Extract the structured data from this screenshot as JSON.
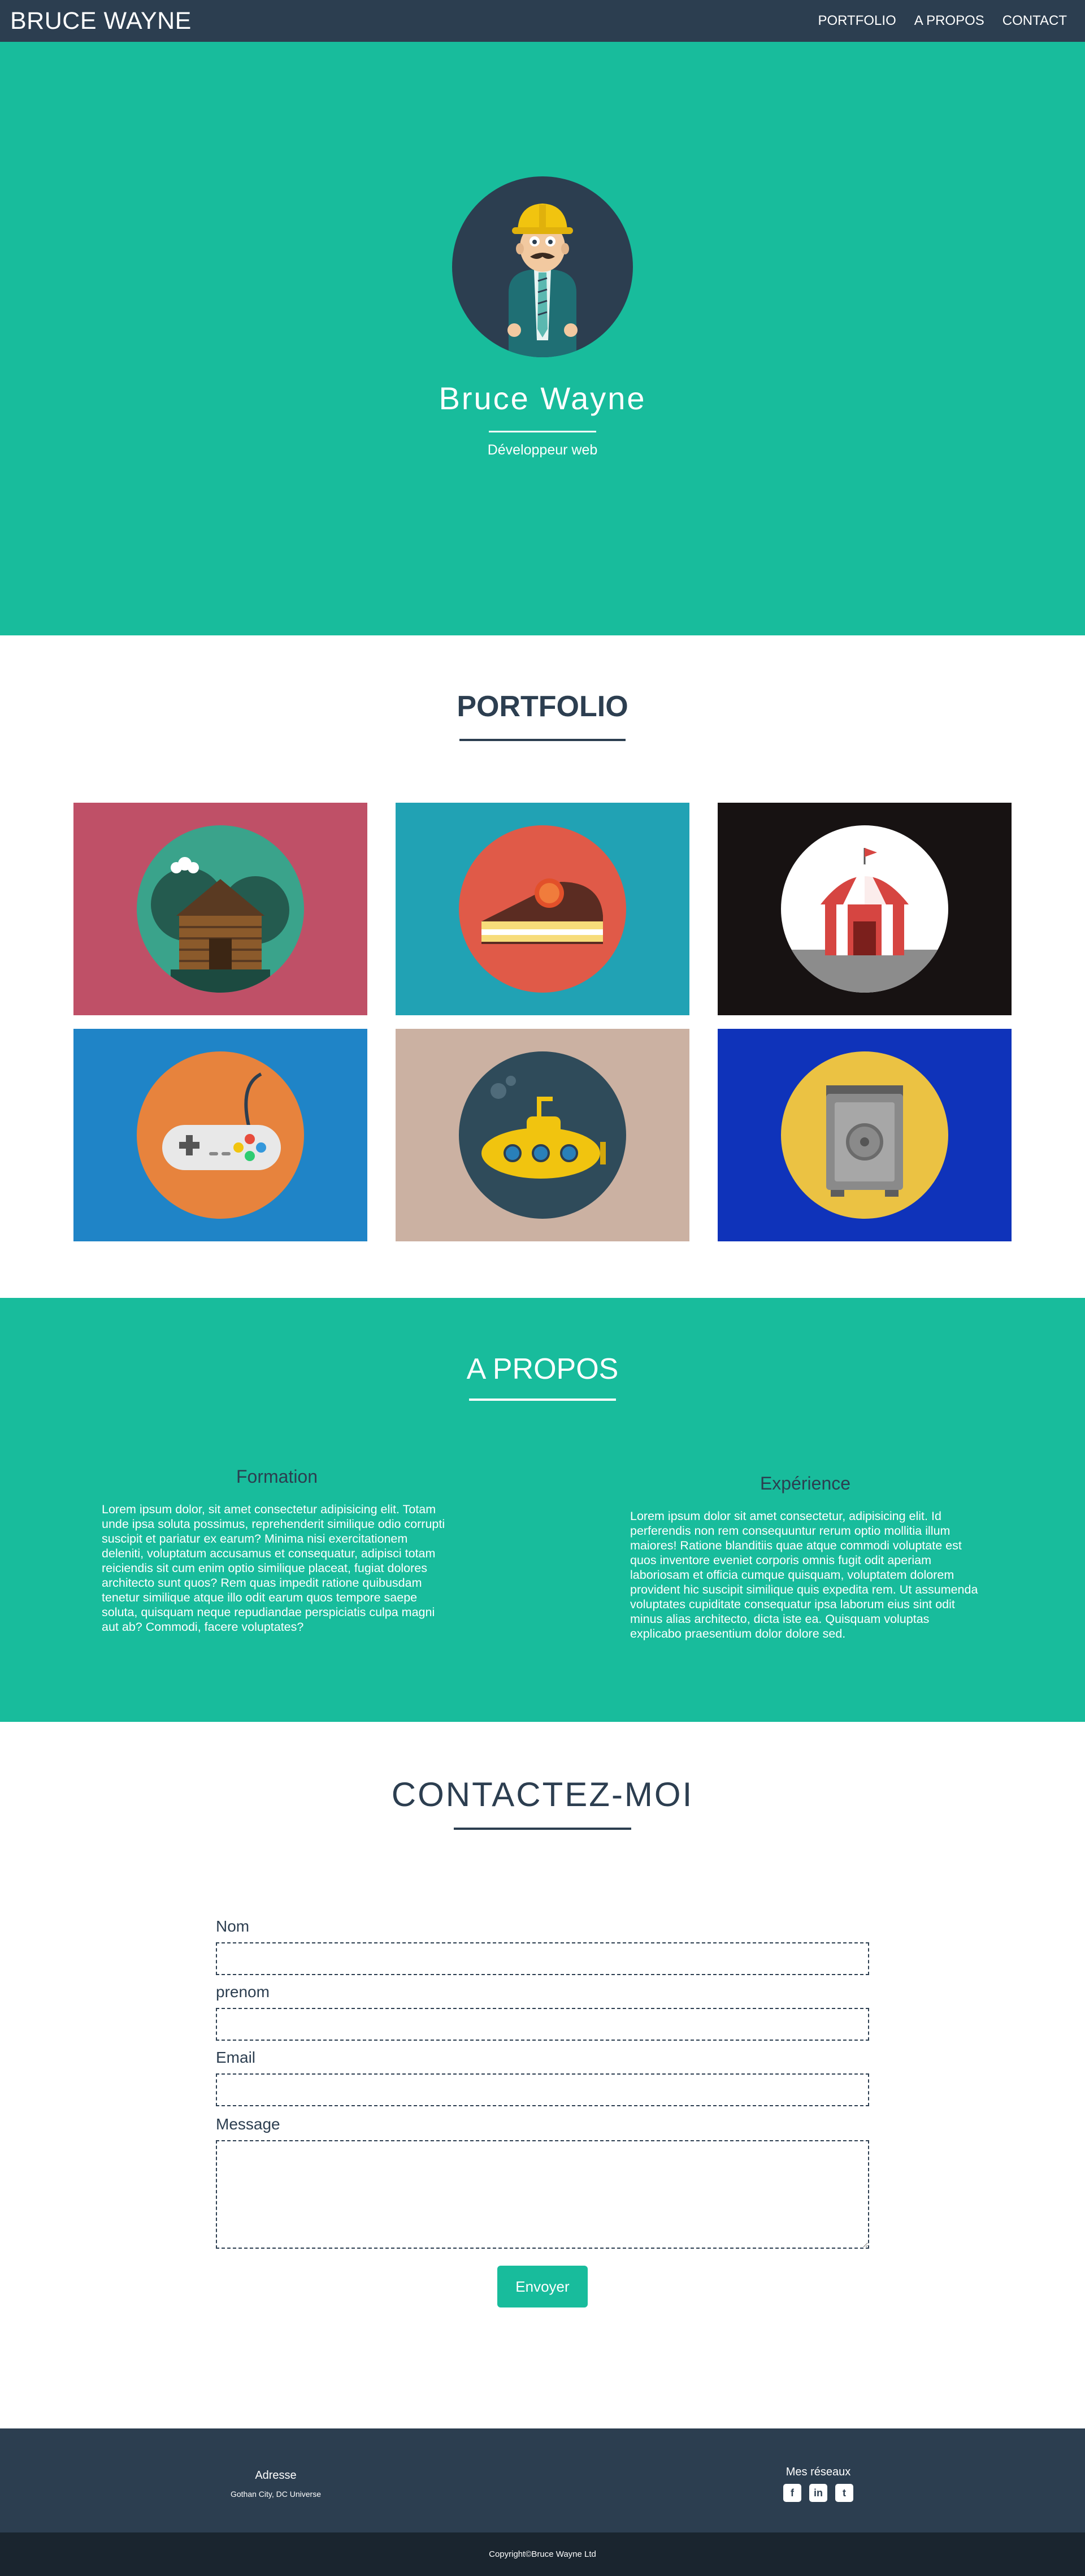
{
  "navbar": {
    "brand": "BRUCE WAYNE",
    "links": [
      "PORTFOLIO",
      "A PROPOS",
      "CONTACT"
    ]
  },
  "hero": {
    "name": "Bruce Wayne",
    "subtitle": "Développeur web",
    "avatar_icon": "builder-avatar-icon"
  },
  "portfolio": {
    "title": "PORTFOLIO",
    "items": [
      {
        "icon": "cabin-icon",
        "bg": "#bf5067",
        "circle": "#3aa38b"
      },
      {
        "icon": "cake-icon",
        "bg": "#21a2b4",
        "circle": "#e05a48"
      },
      {
        "icon": "circus-tent-icon",
        "bg": "#171212",
        "circle": "#ffffff"
      },
      {
        "icon": "game-controller-icon",
        "bg": "#1f84c7",
        "circle": "#e7833d"
      },
      {
        "icon": "submarine-icon",
        "bg": "#cbb1a2",
        "circle": "#2f4b5a"
      },
      {
        "icon": "safe-icon",
        "bg": "#0f33ba",
        "circle": "#ebc243"
      }
    ]
  },
  "about": {
    "title": "A PROPOS",
    "formation": {
      "heading": "Formation",
      "text": "Lorem ipsum dolor, sit amet consectetur adipisicing elit. Totam unde ipsa soluta possimus, reprehenderit similique odio corrupti suscipit et pariatur ex earum? Minima nisi exercitationem deleniti, voluptatum accusamus et consequatur, adipisci totam reiciendis sit cum enim optio similique placeat, fugiat dolores architecto sunt quos? Rem quas impedit ratione quibusdam tenetur similique atque illo odit earum quos tempore saepe soluta, quisquam neque repudiandae perspiciatis culpa magni aut ab? Commodi, facere voluptates?"
    },
    "experience": {
      "heading": "Expérience",
      "text": "Lorem ipsum dolor sit amet consectetur, adipisicing elit. Id perferendis non rem consequuntur rerum optio mollitia illum maiores! Ratione blanditiis quae atque commodi voluptate est quos inventore eveniet corporis omnis fugit odit aperiam laboriosam et officia cumque quisquam, voluptatem dolorem provident hic suscipit similique quis expedita rem. Ut assumenda voluptates cupiditate consequatur ipsa laborum eius sint odit minus alias architecto, dicta iste ea. Quisquam voluptas explicabo praesentium dolor dolore sed."
    }
  },
  "contact": {
    "title": "CONTACTEZ-MOI",
    "fields": {
      "nom_label": "Nom",
      "nom_value": "",
      "prenom_label": "prenom",
      "prenom_value": "",
      "email_label": "Email",
      "email_value": "",
      "message_label": "Message",
      "message_value": ""
    },
    "submit_label": "Envoyer"
  },
  "footer": {
    "address_title": "Adresse",
    "address_text": "Gothan City, DC Universe",
    "social_title": "Mes réseaux",
    "social_icons": [
      "facebook-icon",
      "linkedin-icon",
      "twitter-icon"
    ],
    "copyright": "Copyright©Bruce Wayne Ltd"
  },
  "colors": {
    "primary": "#2c3e50",
    "accent": "#18bc9c",
    "footer_bottom": "#1a252f"
  }
}
